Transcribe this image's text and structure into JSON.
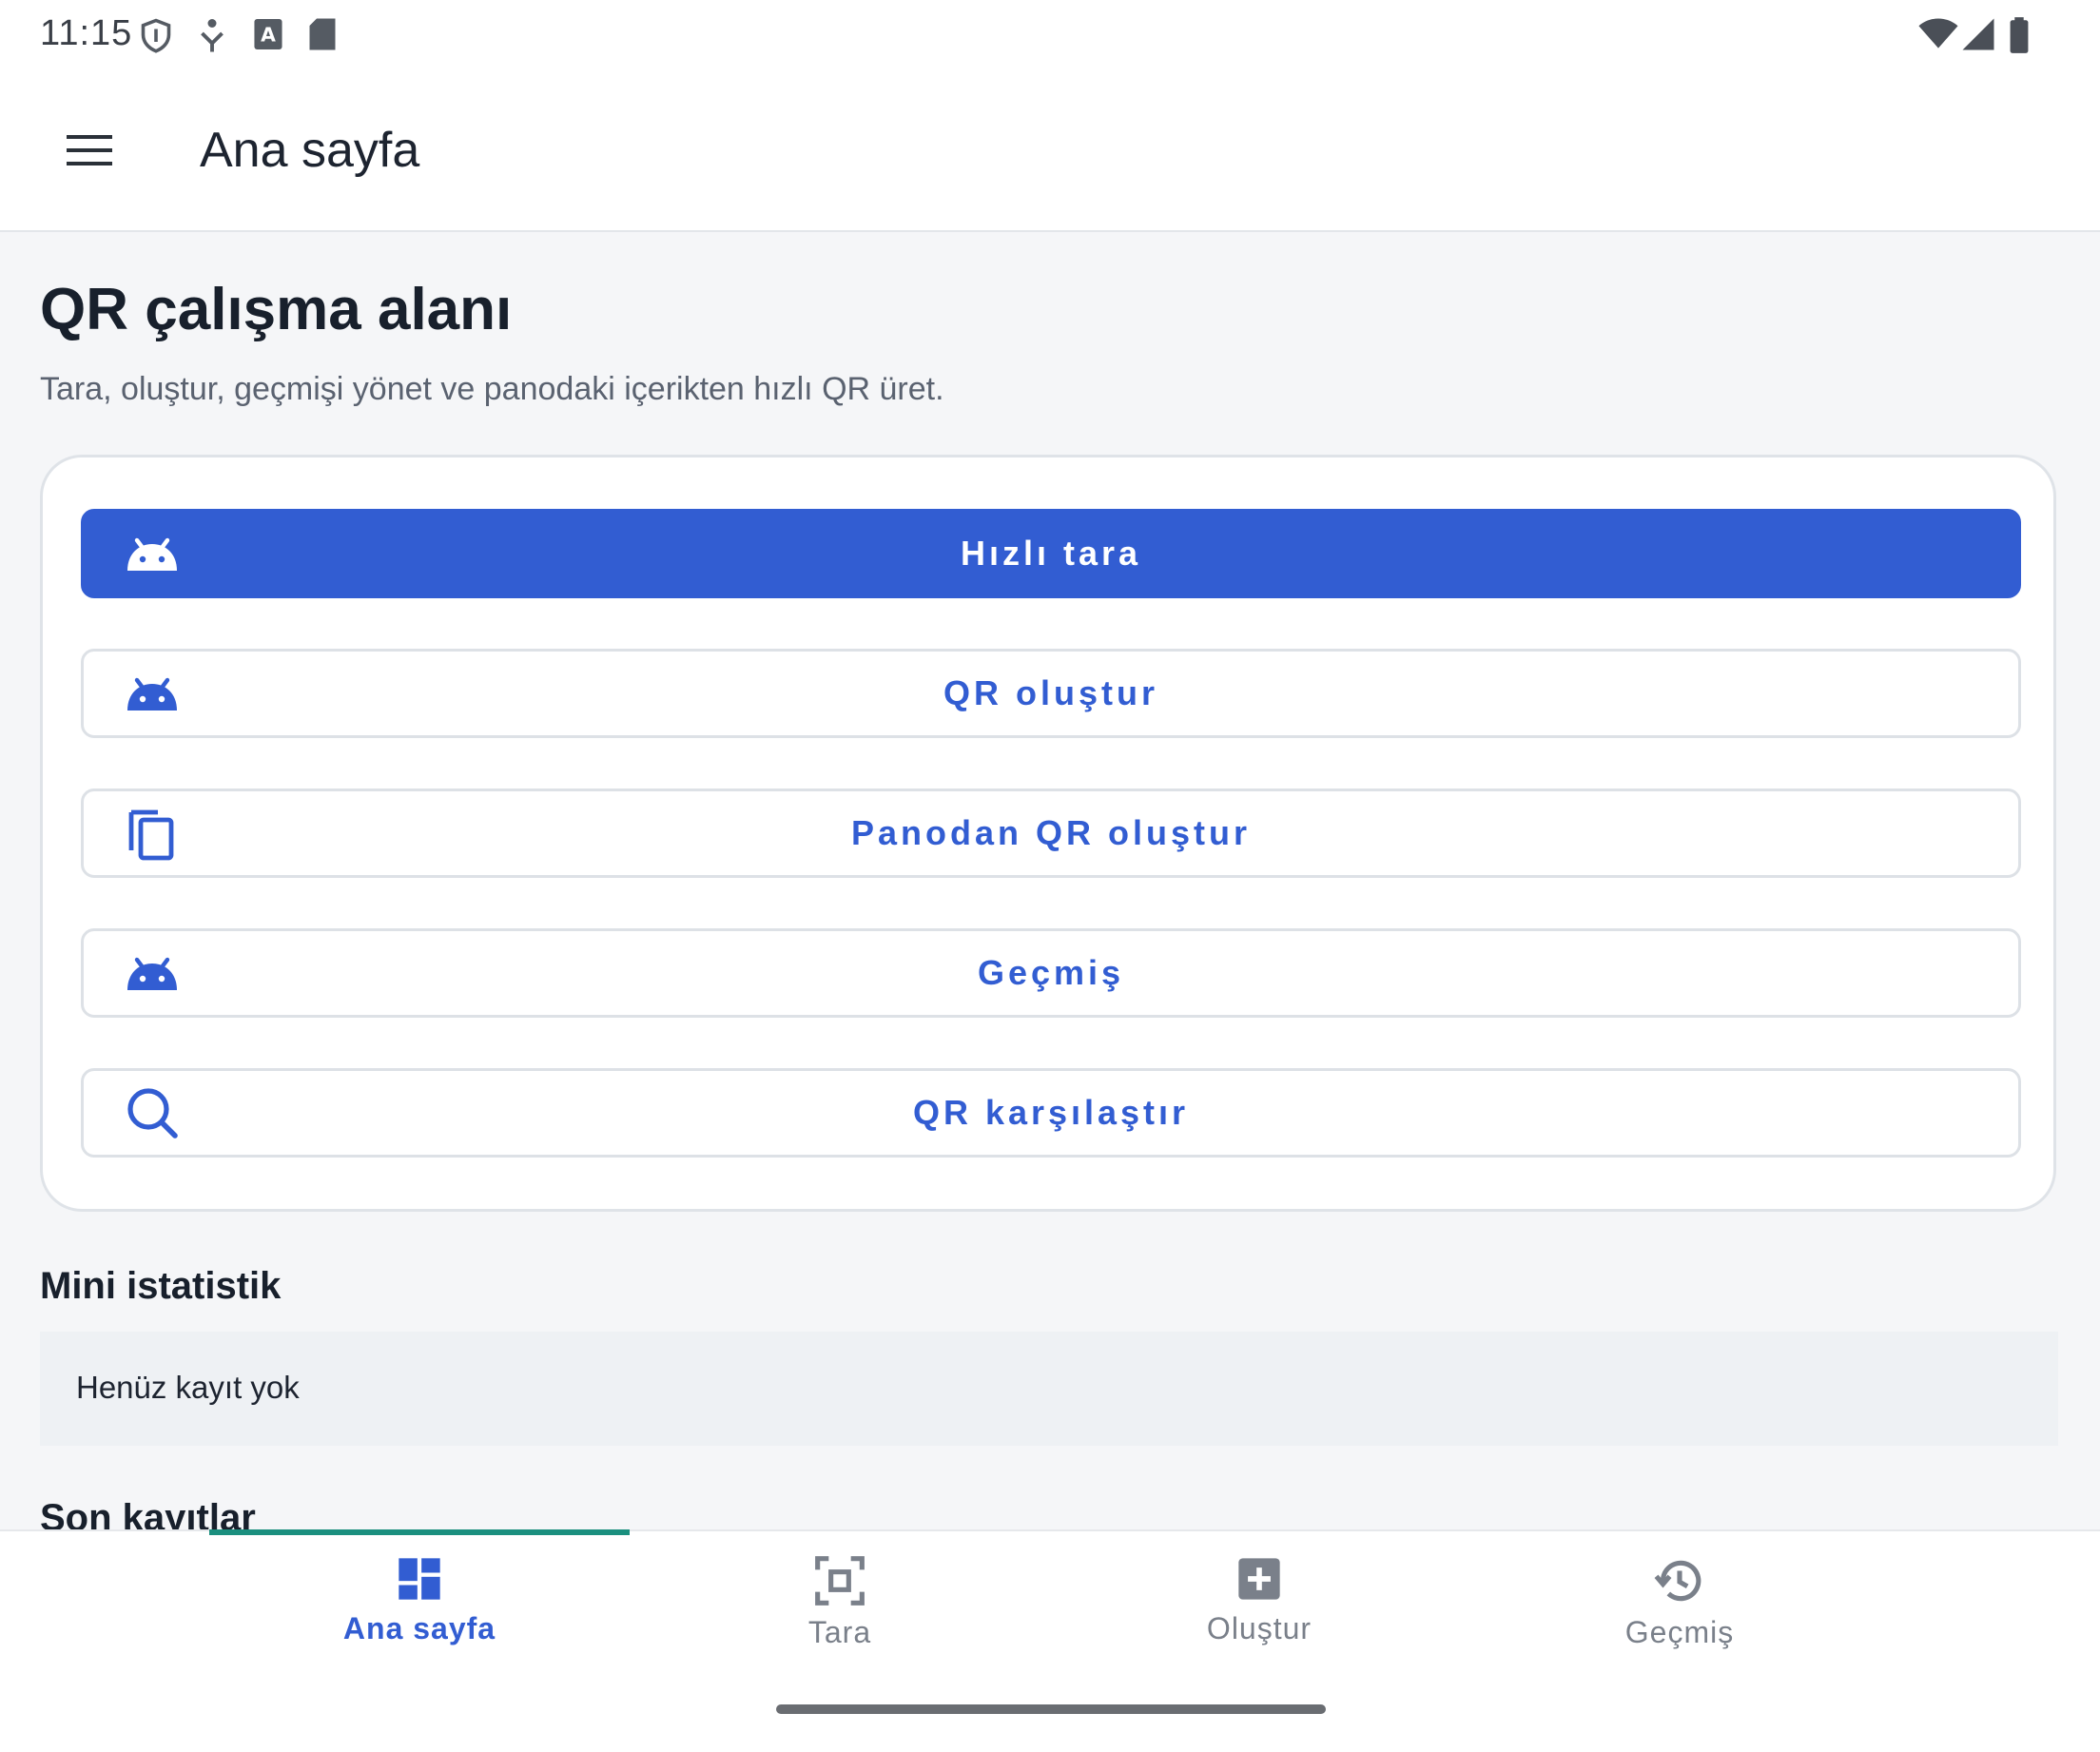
{
  "status_bar": {
    "time": "11:15",
    "left_icons": [
      "shield-icon",
      "network-icon",
      "keyboard-a-icon",
      "sd-card-icon"
    ],
    "right_icons": [
      "wifi-icon",
      "signal-icon",
      "battery-icon"
    ]
  },
  "app_bar": {
    "menu_icon": "hamburger-menu-icon",
    "title": "Ana sayfa"
  },
  "page": {
    "title": "QR çalışma alanı",
    "subtitle": "Tara, oluştur, geçmişi yönet ve panodaki içerikten hızlı QR üret."
  },
  "actions": [
    {
      "label": "Hızlı tara",
      "icon": "android-icon",
      "primary": true
    },
    {
      "label": "QR oluştur",
      "icon": "android-icon",
      "primary": false
    },
    {
      "label": "Panodan QR oluştur",
      "icon": "copy-icon",
      "primary": false
    },
    {
      "label": "Geçmiş",
      "icon": "android-icon",
      "primary": false
    },
    {
      "label": "QR karşılaştır",
      "icon": "search-icon",
      "primary": false
    }
  ],
  "mini_stats": {
    "title": "Mini istatistik",
    "empty_text": "Henüz kayıt yok"
  },
  "recent": {
    "title": "Son kayıtlar"
  },
  "bottom_nav": [
    {
      "label": "Ana sayfa",
      "icon": "dashboard-icon",
      "active": true
    },
    {
      "label": "Tara",
      "icon": "scan-icon",
      "active": false
    },
    {
      "label": "Oluştur",
      "icon": "add-box-icon",
      "active": false
    },
    {
      "label": "Geçmiş",
      "icon": "history-icon",
      "active": false
    }
  ],
  "colors": {
    "primary": "#325dd2",
    "indicator": "#1a8f7e",
    "inactive": "#7a808a",
    "background": "#f5f6f8"
  }
}
